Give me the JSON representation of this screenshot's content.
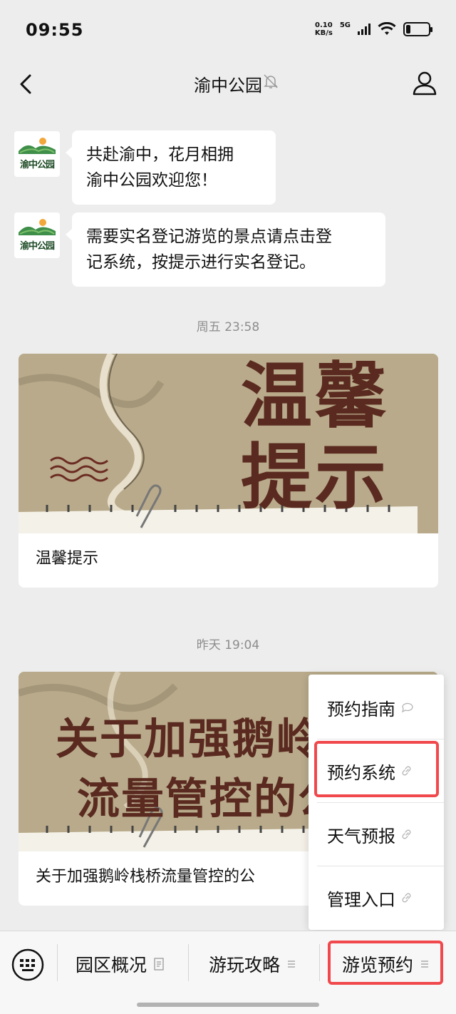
{
  "status": {
    "time": "09:55",
    "net_speed_value": "0.10",
    "net_speed_unit": "KB/s",
    "network": "5G",
    "battery_level": 0.2
  },
  "header": {
    "title": "渝中公园",
    "back_icon": "chevron-left-icon",
    "mute_icon": "bell-off-icon",
    "profile_icon": "person-icon"
  },
  "messages": [
    {
      "text_line1": "共赴渝中，花月相拥",
      "text_line2": "渝中公园欢迎您！"
    },
    {
      "text_line1": "需要实名登记游览的景点请点击登",
      "text_line2": "记系统，按提示进行实名登记。"
    }
  ],
  "avatar": {
    "logo_text": "渝中公园"
  },
  "timestamps": [
    "周五 23:58",
    "昨天 19:04"
  ],
  "articles": [
    {
      "cover_text_line1": "温馨",
      "cover_text_line2": "提示",
      "title": "温馨提示"
    },
    {
      "cover_text_line1": "关于加强鹅岭",
      "cover_text_line2": "流量管控的公",
      "title": "关于加强鹅岭栈桥流量管控的公"
    }
  ],
  "popup_menu": {
    "items": [
      {
        "label": "预约指南",
        "icon": "chat-bubble-icon",
        "highlighted": false
      },
      {
        "label": "预约系统",
        "icon": "link-icon",
        "highlighted": true
      },
      {
        "label": "天气预报",
        "icon": "link-icon",
        "highlighted": false
      },
      {
        "label": "管理入口",
        "icon": "link-icon",
        "highlighted": false
      }
    ]
  },
  "bottom_menu": {
    "keyboard_icon": "keyboard-icon",
    "items": [
      {
        "label": "园区概况",
        "icon": "document-icon"
      },
      {
        "label": "游玩攻略",
        "icon": "menu-lines-icon"
      },
      {
        "label": "游览预约",
        "icon": "menu-lines-icon",
        "highlighted": true
      }
    ]
  },
  "colors": {
    "background": "#ededed",
    "highlight": "#f0484c",
    "cover_bg": "#b7a98a",
    "cover_text": "#5a2a20",
    "timestamp": "#8c8c8c"
  }
}
